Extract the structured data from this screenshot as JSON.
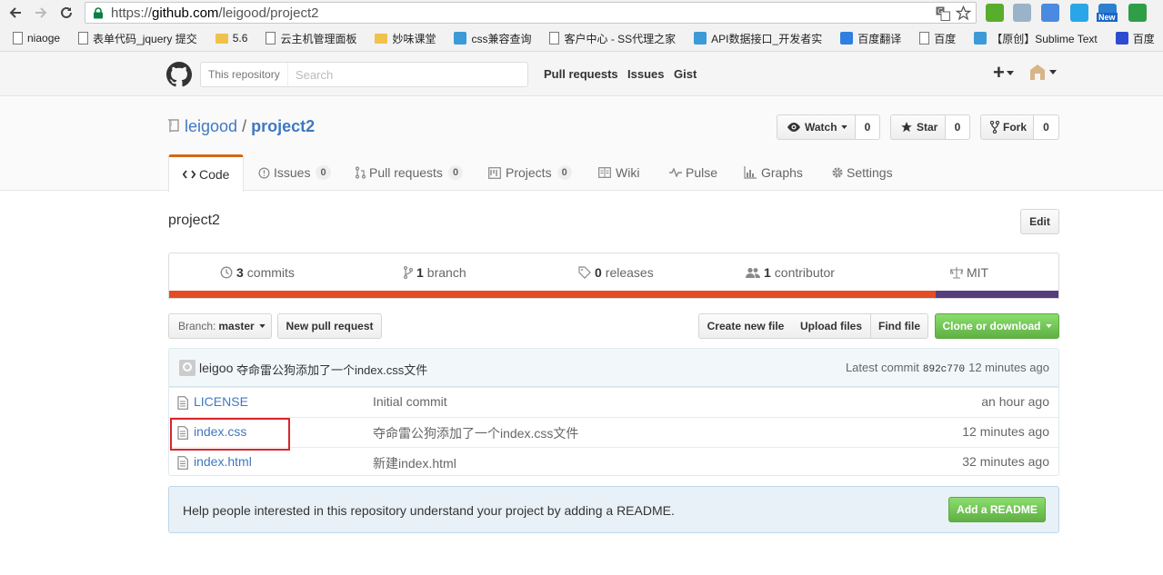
{
  "browser": {
    "url_scheme": "https://",
    "url_host": "github.com",
    "url_path": "/leigood/project2",
    "bookmarks": [
      {
        "label": "niaoge",
        "icon": "page-icon"
      },
      {
        "label": "表单代码_jquery 提交",
        "icon": "page-icon"
      },
      {
        "label": "5.6",
        "icon": "folder-icon"
      },
      {
        "label": "云主机管理面板",
        "icon": "page-icon"
      },
      {
        "label": "妙味课堂",
        "icon": "folder-icon"
      },
      {
        "label": "css兼容查询",
        "icon": "site-icon"
      },
      {
        "label": "客户中心 - SS代理之家",
        "icon": "page-icon"
      },
      {
        "label": "API数据接口_开发者实",
        "icon": "site-icon"
      },
      {
        "label": "百度翻译",
        "icon": "translate-icon"
      },
      {
        "label": "百度",
        "icon": "page-icon"
      },
      {
        "label": "【原创】Sublime Text",
        "icon": "site-icon"
      },
      {
        "label": "百度",
        "icon": "baidu-icon"
      }
    ],
    "new_badge": "New"
  },
  "header": {
    "search_scope": "This repository",
    "search_placeholder": "Search",
    "nav": [
      "Pull requests",
      "Issues",
      "Gist"
    ],
    "plus": "+"
  },
  "repo": {
    "owner": "leigood",
    "separator": "/",
    "name": "project2",
    "watch_label": "Watch",
    "watch_count": "0",
    "star_label": "Star",
    "star_count": "0",
    "fork_label": "Fork",
    "fork_count": "0",
    "tabs": [
      {
        "label": "Code",
        "count": ""
      },
      {
        "label": "Issues",
        "count": "0"
      },
      {
        "label": "Pull requests",
        "count": "0"
      },
      {
        "label": "Projects",
        "count": "0"
      },
      {
        "label": "Wiki",
        "count": ""
      },
      {
        "label": "Pulse",
        "count": ""
      },
      {
        "label": "Graphs",
        "count": ""
      },
      {
        "label": "Settings",
        "count": ""
      }
    ],
    "description": "project2",
    "edit_label": "Edit"
  },
  "summary": {
    "commits_num": "3",
    "commits_label": "commits",
    "branch_num": "1",
    "branch_label": "branch",
    "releases_num": "0",
    "releases_label": "releases",
    "contributor_num": "1",
    "contributor_label": "contributor",
    "license": "MIT",
    "lang_colors": [
      "#e34c26",
      "#563d7c"
    ],
    "lang_share": [
      0.862,
      0.138
    ]
  },
  "filebar": {
    "branch_prefix": "Branch:",
    "branch_name": "master",
    "new_pr": "New pull request",
    "create_file": "Create new file",
    "upload_files": "Upload files",
    "find_file": "Find file",
    "clone_download": "Clone or download"
  },
  "commit": {
    "author": "leigoo",
    "message": "夺命雷公狗添加了一个index.css文件",
    "latest_label": "Latest commit",
    "sha": "892c770",
    "age": "12 minutes ago"
  },
  "files": [
    {
      "name": "LICENSE",
      "message": "Initial commit",
      "age": "an hour ago"
    },
    {
      "name": "index.css",
      "message": "夺命雷公狗添加了一个index.css文件",
      "age": "12 minutes ago"
    },
    {
      "name": "index.html",
      "message": "新建index.html",
      "age": "32 minutes ago"
    }
  ],
  "readme": {
    "text": "Help people interested in this repository understand your project by adding a README.",
    "button": "Add a README"
  }
}
